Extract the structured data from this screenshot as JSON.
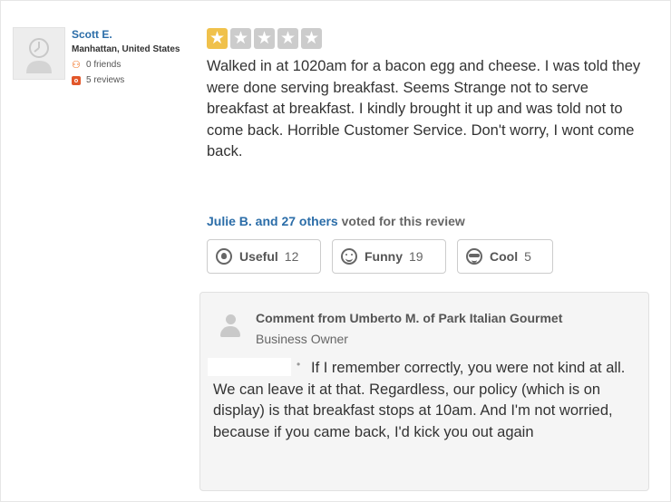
{
  "reviewer": {
    "name": "Scott E.",
    "location": "Manhattan, United States",
    "friends": "0 friends",
    "reviews": "5 reviews"
  },
  "review": {
    "rating": 1,
    "max_rating": 5,
    "text": "Walked in at 1020am for a bacon egg and cheese. I was told they were done serving breakfast. Seems Strange not to serve breakfast at breakfast. I kindly brought it up and was told not to come back. Horrible Customer Service. Don't worry, I wont come back.",
    "voted_who": "Julie B. and 27 others",
    "voted_rest": " voted for this review"
  },
  "votes": {
    "useful": {
      "label": "Useful",
      "count": "12"
    },
    "funny": {
      "label": "Funny",
      "count": "19"
    },
    "cool": {
      "label": "Cool",
      "count": "5"
    }
  },
  "comment": {
    "from": "Comment from Umberto M. of Park Italian Gourmet",
    "role": "Business Owner",
    "bullet": "•",
    "text": "If I remember correctly, you were not kind at all. We can leave it at that. Regardless, our policy (which is on display) is that breakfast stops at 10am. And I'm not worried, because if you came back, I'd kick you out again"
  },
  "colors": {
    "link": "#2b6da8",
    "star_on": "#f0c14b",
    "star_off": "#cccccc"
  }
}
